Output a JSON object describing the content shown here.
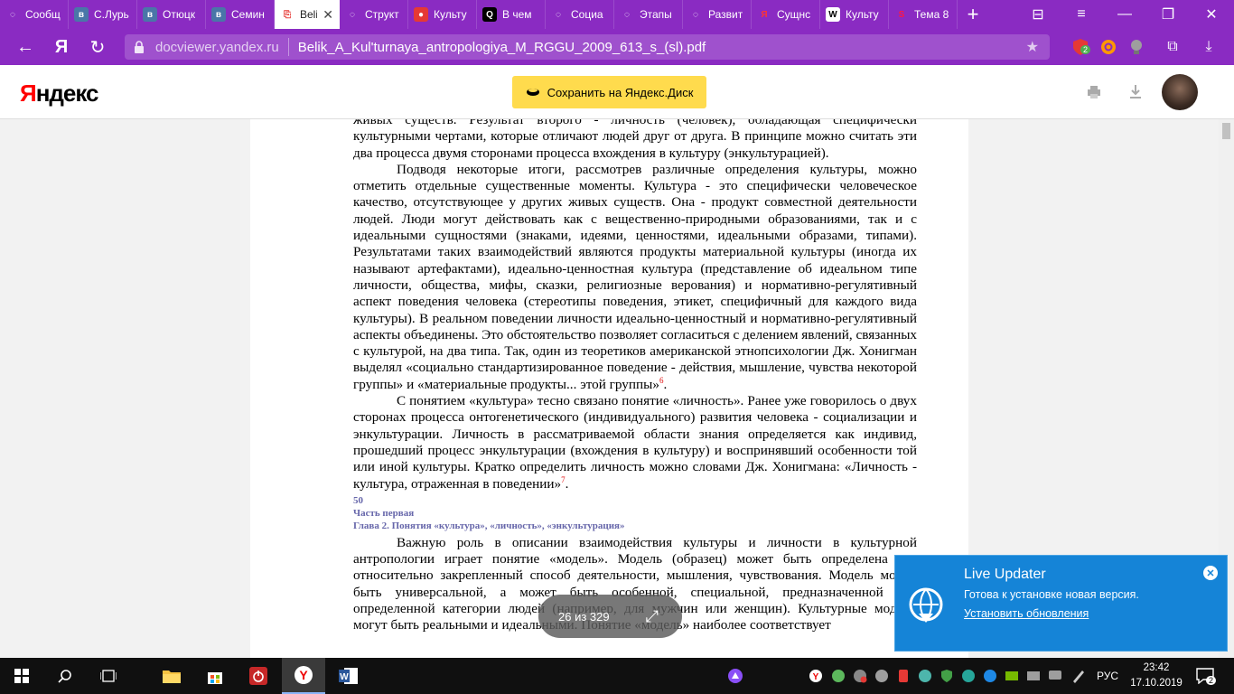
{
  "browser": {
    "tabs": [
      {
        "label": "Сообщ",
        "icon": "loading-icon"
      },
      {
        "label": "С.Лурь",
        "icon": "vk-icon"
      },
      {
        "label": "Отюцк",
        "icon": "vk-icon"
      },
      {
        "label": "Семин",
        "icon": "vk-icon"
      },
      {
        "label": "Belik",
        "icon": "pdf-icon",
        "active": true
      },
      {
        "label": "Структ",
        "icon": "loading-icon"
      },
      {
        "label": "Культу",
        "icon": "site-icon"
      },
      {
        "label": "В чем",
        "icon": "q-icon"
      },
      {
        "label": "Социа",
        "icon": "loading-icon"
      },
      {
        "label": "Этапы",
        "icon": "loading-icon"
      },
      {
        "label": "Развит",
        "icon": "loading-icon"
      },
      {
        "label": "Сущнс",
        "icon": "yandex-icon"
      },
      {
        "label": "Культу",
        "icon": "wikipedia-icon"
      },
      {
        "label": "Тема 8",
        "icon": "s-icon"
      }
    ],
    "domain": "docviewer.yandex.ru",
    "page_title": "Belik_A_Kul'turnaya_antropologiya_M_RGGU_2009_613_s_(sl).pdf",
    "badge_count": "2"
  },
  "viewer": {
    "logo_left": "Я",
    "logo_rest": "ндекс",
    "save_label": "Сохранить на Яндекс.Диск",
    "page_counter": "26 из 329"
  },
  "document": {
    "p1": "живых существ. Результат второго - личность (человек), обладающая специфически культурными чертами, которые отличают людей друг от друга. В принципе можно считать эти два процесса двумя сторонами процесса вхождения в культуру (энкультурацией).",
    "p2": "Подводя некоторые итоги, рассмотрев различные определения культуры, можно отметить отдельные существенные моменты. Культура - это специфически человеческое качество, отсутствующее у других живых существ. Она - продукт совместной деятельности людей. Люди могут действовать как с вещественно-природными образованиями, так и с идеальными сущностями (знаками, идеями, ценностями, идеальными образами, типами). Результатами таких взаимодействий являются продукты материальной культуры (иногда их называют артефактами), идеально-ценностная культура (представление об идеальном типе личности, общества, мифы, сказки, религиозные верования) и нормативно-регулятивный аспект поведения человека (стереотипы поведения, этикет, специфичный для каждого вида культуры). В реальном поведении личности идеально-ценностный и нормативно-регулятивный аспекты объединены. Это обстоятельство позволяет согласиться с делением явлений, связанных с культурой, на два типа. Так, один из теоретиков американской этнопсихологии Дж. Хонигман выделял «социально стандартизированное поведение - действия, мышление, чувства некоторой группы» и «материальные продукты... этой группы»",
    "fn6": "6",
    "p3": "С понятием «культура» тесно связано понятие «личность». Ранее уже говорилось о двух сторонах процесса онтогенетического (индивидуального) развития человека - социализации и энкультурации. Личность в рассматриваемой области знания определяется как индивид, прошедший процесс энкультурации (вхождения в культуру) и воспринявший особенности той или иной культуры. Кратко определить личность можно словами Дж. Хонигмана: «Личность - культура, отраженная в поведении»",
    "fn7": "7",
    "page_number": "50",
    "part": "Часть первая",
    "chapter": "Глава 2. Понятия «культура», «личность», «энкультурация»",
    "p4": "Важную роль в описании взаимодействия культуры и личности в культурной антропологии играет понятие «модель». Модель (образец) может быть определена как относительно закрепленный способ деятельности, мышления, чувствования. Модель может быть универсальной, а может быть особенной, специальной, предназначенной для определенной категории людей (например, для мужчин или женщин). Культурные модели могут быть реальными и идеальными. Понятие «модель» наиболее соответствует"
  },
  "notification": {
    "title": "Live Updater",
    "message": "Готова к установке новая версия.",
    "link": "Установить обновления"
  },
  "taskbar": {
    "language": "РУС",
    "time": "23:42",
    "date": "17.10.2019",
    "notifications_count": "2"
  },
  "colors": {
    "browser_purple": "#8a2bc2",
    "yandex_yellow": "#ffdb4d",
    "toast_blue": "#1584d7",
    "heading_gray_blue": "#6666aa"
  }
}
